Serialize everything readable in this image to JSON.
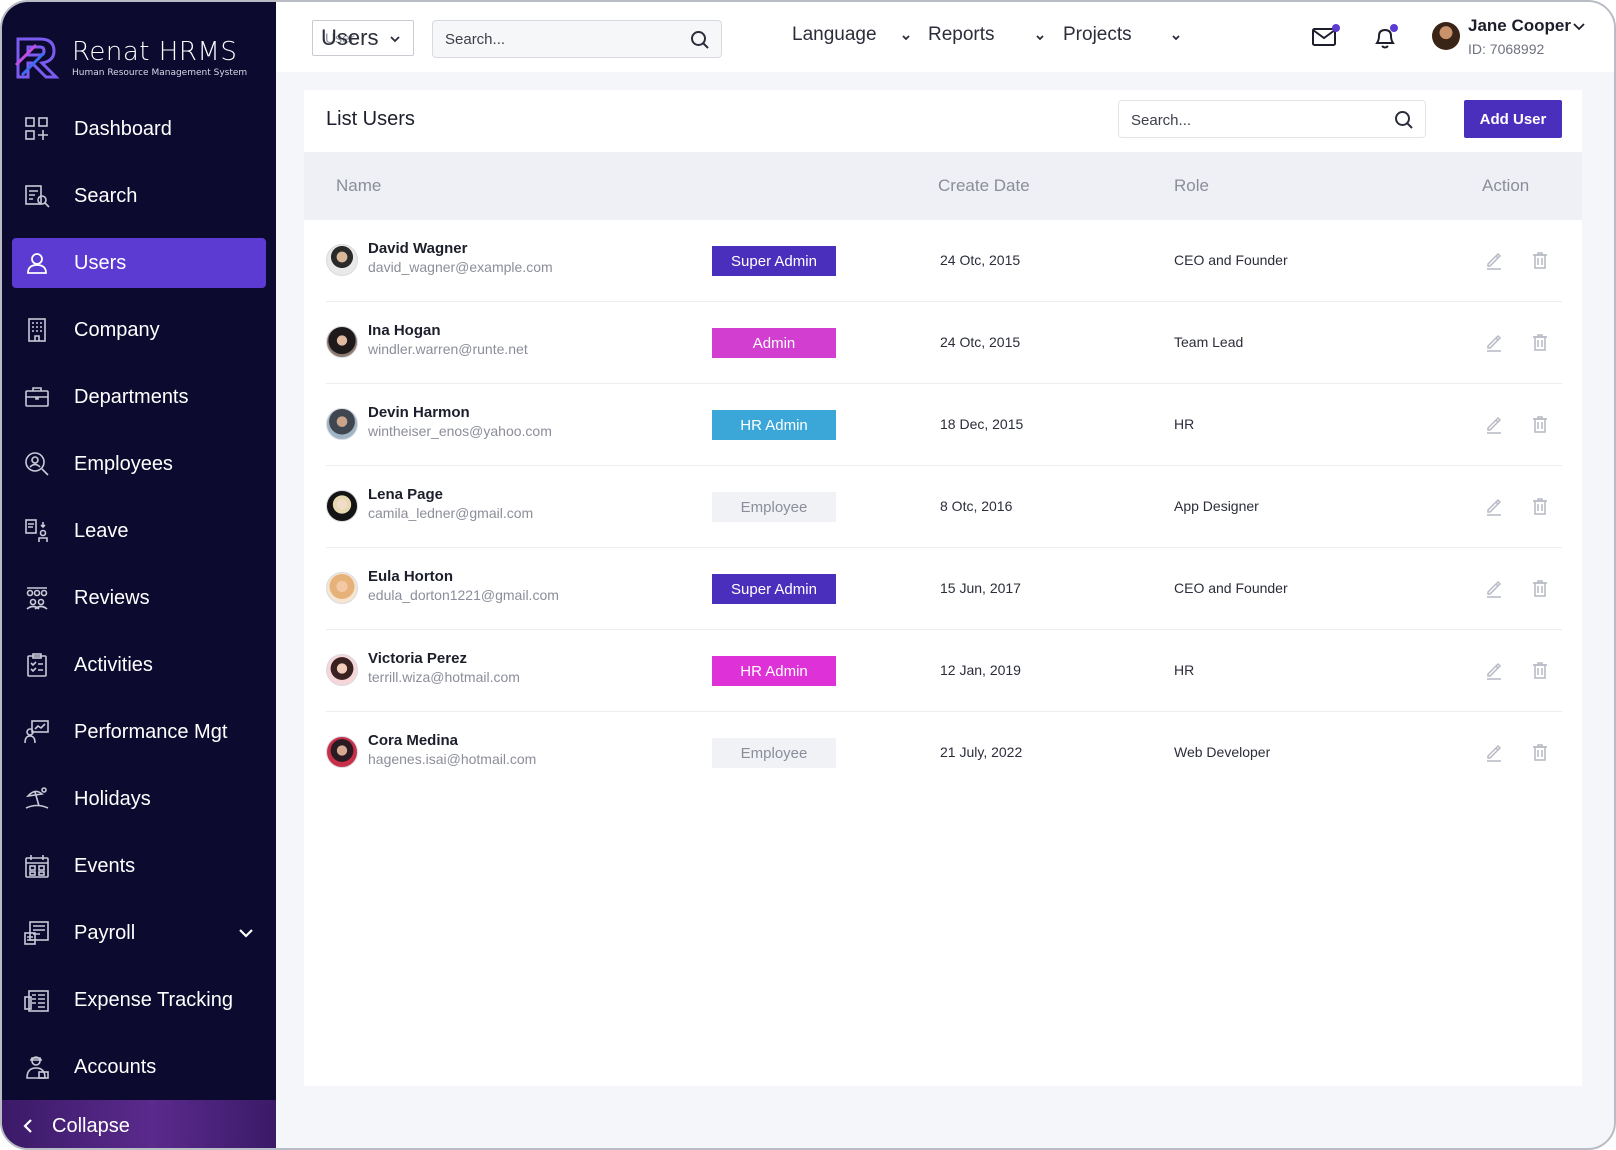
{
  "brand": {
    "name": "Renat HRMS",
    "subtitle": "Human Resource Management System"
  },
  "sidebar": {
    "items": [
      {
        "label": "Dashboard",
        "icon": "dashboard-icon",
        "active": false
      },
      {
        "label": "Search",
        "icon": "search-list-icon",
        "active": false
      },
      {
        "label": "Users",
        "icon": "user-icon",
        "active": true
      },
      {
        "label": "Company",
        "icon": "building-icon",
        "active": false
      },
      {
        "label": "Departments",
        "icon": "briefcase-icon",
        "active": false
      },
      {
        "label": "Employees",
        "icon": "employee-search-icon",
        "active": false
      },
      {
        "label": "Leave",
        "icon": "leave-icon",
        "active": false
      },
      {
        "label": "Reviews",
        "icon": "team-icon",
        "active": false
      },
      {
        "label": "Activities",
        "icon": "clipboard-icon",
        "active": false
      },
      {
        "label": "Performance Mgt",
        "icon": "performance-icon",
        "active": false
      },
      {
        "label": "Holidays",
        "icon": "beach-icon",
        "active": false
      },
      {
        "label": "Events",
        "icon": "calendar-icon",
        "active": false
      },
      {
        "label": "Payroll",
        "icon": "payroll-icon",
        "active": false
      },
      {
        "label": "Expense Tracking",
        "icon": "expense-icon",
        "active": false
      },
      {
        "label": "Accounts",
        "icon": "accounts-icon",
        "active": false
      }
    ],
    "collapse_label": "Collapse"
  },
  "topbar": {
    "page_select_ghost": "User",
    "page_select_value": "Users",
    "search_placeholder": "Search...",
    "menus": [
      "Language",
      "Reports",
      "Projects"
    ],
    "user": {
      "name": "Jane Cooper",
      "id": "ID: 7068992"
    }
  },
  "main": {
    "title": "List Users",
    "search_placeholder": "Search...",
    "add_button": "Add User",
    "columns": {
      "name": "Name",
      "create_date": "Create Date",
      "role": "Role",
      "action": "Action"
    },
    "rows": [
      {
        "name": "David Wagner",
        "email": "david_wagner@example.com",
        "badge": "Super Admin",
        "date": "24 Otc, 2015",
        "role": "CEO and Founder"
      },
      {
        "name": "Ina Hogan",
        "email": "windler.warren@runte.net",
        "badge": "Admin",
        "date": "24 Otc, 2015",
        "role": "Team Lead"
      },
      {
        "name": "Devin Harmon",
        "email": "wintheiser_enos@yahoo.com",
        "badge": "HR Admin",
        "date": "18 Dec, 2015",
        "role": "HR"
      },
      {
        "name": "Lena Page",
        "email": "camila_ledner@gmail.com",
        "badge": "Employee",
        "date": "8 Otc, 2016",
        "role": "App Designer"
      },
      {
        "name": "Eula Horton",
        "email": "edula_dorton1221@gmail.com",
        "badge": "Super Admin",
        "date": "15 Jun, 2017",
        "role": "CEO and Founder"
      },
      {
        "name": "Victoria Perez",
        "email": "terrill.wiza@hotmail.com",
        "badge": "HR Admin",
        "date": "12 Jan, 2019",
        "role": "HR"
      },
      {
        "name": "Cora Medina",
        "email": "hagenes.isai@hotmail.com",
        "badge": "Employee",
        "date": "21 July, 2022",
        "role": "Web Developer"
      }
    ]
  },
  "colors": {
    "sidebar_bg": "#0c0a2e",
    "accent": "#5b3bd1",
    "button": "#4a2fbd",
    "super_admin": "#4a2fbd",
    "admin": "#d23ed0",
    "hr_admin_blue": "#3ba7d8",
    "hr_admin_pink": "#df31d8",
    "employee_bg": "#f1f2f6",
    "employee_text": "#8b8e9a"
  }
}
